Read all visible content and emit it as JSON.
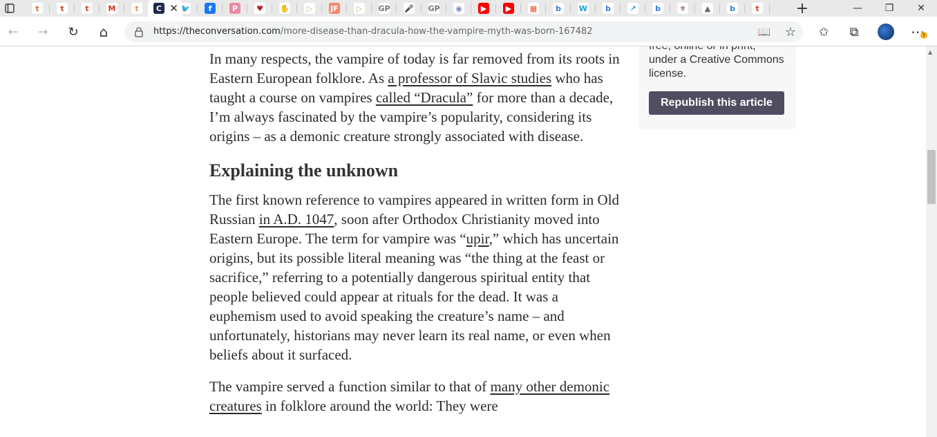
{
  "browser": {
    "tabs": [
      {
        "glyph": "t",
        "bg": "#ffffff",
        "fg": "#e06a3a"
      },
      {
        "glyph": "t",
        "bg": "#ffffff",
        "fg": "#d1401a"
      },
      {
        "glyph": "t",
        "bg": "#ffffff",
        "fg": "#d1401a"
      },
      {
        "glyph": "M",
        "bg": "#ffffff",
        "fg": "#d93025"
      },
      {
        "glyph": "C",
        "bg": "#1b2a4a",
        "fg": "#ffffff"
      },
      {
        "glyph": "t",
        "bg": "#ffffff",
        "fg": "#e58d6a"
      },
      {
        "glyph": "🐦",
        "bg": "#ffffff",
        "fg": "#1d9bf0"
      },
      {
        "glyph": "f",
        "bg": "#1877f2",
        "fg": "#ffffff"
      },
      {
        "glyph": "P",
        "bg": "#e88aa4",
        "fg": "#ffffff"
      },
      {
        "glyph": "♥",
        "bg": "#ffffff",
        "fg": "#b3261e"
      },
      {
        "glyph": "✋",
        "bg": "#ffffff",
        "fg": "#9a9a9a"
      },
      {
        "glyph": "▷",
        "bg": "#ffffff",
        "fg": "#a4c77a"
      },
      {
        "glyph": "JF",
        "bg": "#f08a6a",
        "fg": "#ffffff"
      },
      {
        "glyph": "▷",
        "bg": "#ffffff",
        "fg": "#a4c77a"
      },
      {
        "glyph": "GP",
        "bg": "#ffffff",
        "fg": "#777777"
      },
      {
        "glyph": "🎤",
        "bg": "#ffffff",
        "fg": "#888888"
      },
      {
        "glyph": "GP",
        "bg": "#ffffff",
        "fg": "#777777"
      },
      {
        "glyph": "◉",
        "bg": "#ffffff",
        "fg": "#7c86c8"
      },
      {
        "glyph": "▶",
        "bg": "#ff0000",
        "fg": "#ffffff"
      },
      {
        "glyph": "▶",
        "bg": "#ff0000",
        "fg": "#ffffff"
      },
      {
        "glyph": "▦",
        "bg": "#ffffff",
        "fg": "#f25022"
      },
      {
        "glyph": "b",
        "bg": "#ffffff",
        "fg": "#2a7de1"
      },
      {
        "glyph": "W",
        "bg": "#ffffff",
        "fg": "#1a9ad6"
      },
      {
        "glyph": "b",
        "bg": "#ffffff",
        "fg": "#2a7de1"
      },
      {
        "glyph": "↗",
        "bg": "#ffffff",
        "fg": "#2a9ad6"
      },
      {
        "glyph": "b",
        "bg": "#ffffff",
        "fg": "#2a7de1"
      },
      {
        "glyph": "⚜",
        "bg": "#ffffff",
        "fg": "#7a3b2e"
      },
      {
        "glyph": "▲",
        "bg": "#ffffff",
        "fg": "#666666"
      },
      {
        "glyph": "b",
        "bg": "#ffffff",
        "fg": "#2a7de1"
      },
      {
        "glyph": "t",
        "bg": "#ffffff",
        "fg": "#d1401a"
      }
    ],
    "active_tab_close": "✕",
    "new_tab": "+",
    "window": {
      "minimize": "—",
      "maximize": "❐",
      "close": "✕"
    },
    "toolbar": {
      "back": "←",
      "forward": "→",
      "reload": "↻",
      "home": "⌂",
      "url_host": "https://theconversation.com",
      "url_path": "/more-disease-than-dracula-how-the-vampire-myth-was-born-167482",
      "read_aloud": "📖",
      "add_favorite": "☆",
      "favorites": "✩",
      "collections": "⧉",
      "menu": "⋯"
    }
  },
  "sidebar": {
    "license_text_partial": "free, online or in print, under a Creative Commons license.",
    "republish_button": "Republish this article"
  },
  "article": {
    "para1": {
      "t1": "In many respects, the vampire of today is far removed from its roots in Eastern European folklore. As ",
      "link1": "a professor of Slavic studies",
      "t2": " who has taught a course on vampires ",
      "link2": "called “Dracula”",
      "t3": " for more than a decade, I’m always fascinated by the vampire’s popularity, considering its origins – as a demonic creature strongly associated with disease."
    },
    "heading": "Explaining the unknown",
    "para2": {
      "t1": "The first known reference to vampires appeared in written form in Old Russian ",
      "link1": "in A.D. 1047",
      "t2": ", soon after Orthodox Christianity moved into Eastern Europe. The term for vampire was “",
      "link2": "upir",
      "t3": ",” which has uncertain origins, but its possible literal meaning was “the thing at the feast or sacrifice,” referring to a potentially dangerous spiritual entity that people believed could appear at rituals for the dead. It was a euphemism used to avoid speaking the creature’s name – and unfortunately, historians may never learn its real name, or even when beliefs about it surfaced."
    },
    "para3": {
      "t1": "The vampire served a function similar to that of ",
      "link1": "many other demonic creatures",
      "t2": " in folklore around the world: They were"
    }
  },
  "colors": {
    "tab_strip": "#e9e9e9",
    "omnibox": "#f1f3f4",
    "republish_bg": "#4f4d60",
    "text": "#2b2b2b"
  }
}
